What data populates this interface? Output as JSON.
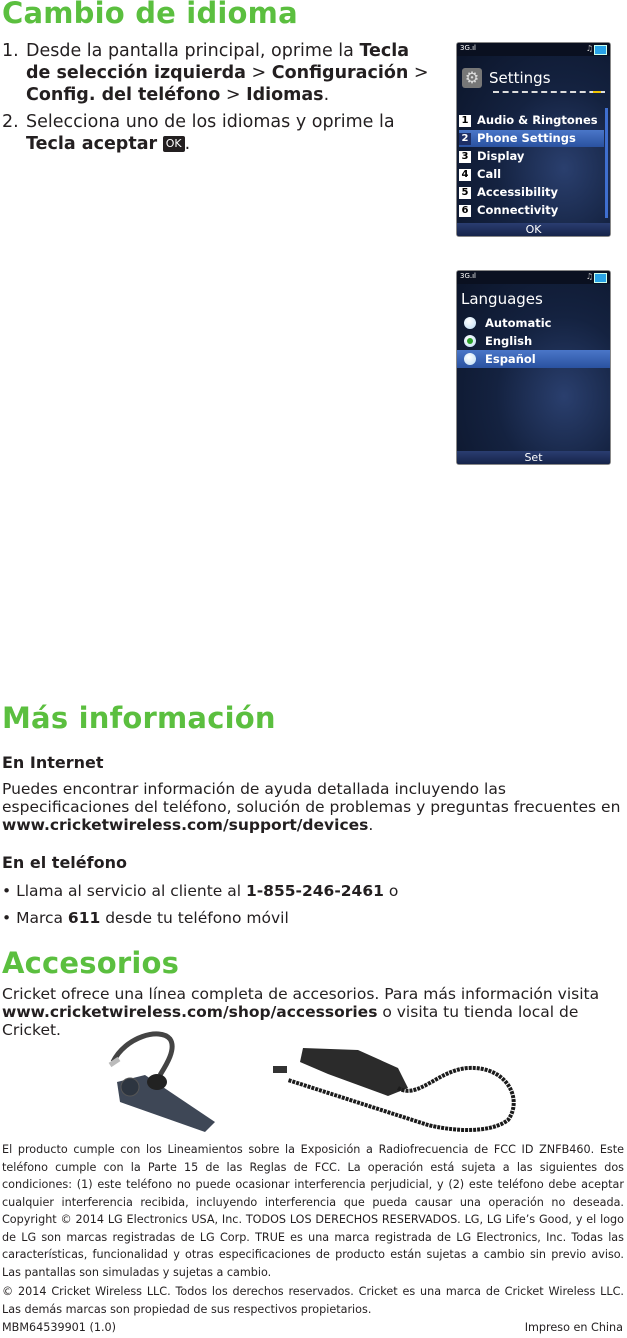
{
  "section1": {
    "title": "Cambio de idioma",
    "steps": [
      {
        "num": "1.",
        "t1": "Desde la pantalla principal, oprime la ",
        "b1": "Tecla de selección izquierda",
        "t2": " > ",
        "b2": "Configuración",
        "t3": " > ",
        "b3": "Config. del teléfono",
        "t4": " > ",
        "b4": "Idiomas",
        "t5": "."
      },
      {
        "num": "2.",
        "t1": "Selecciona uno de los idiomas y oprime la ",
        "b1": "Tecla aceptar",
        "key": "OK",
        "t2": "."
      }
    ]
  },
  "phone_settings": {
    "status_network": "3G",
    "title": "Settings",
    "items": [
      {
        "n": "1",
        "label": "Audio & Ringtones"
      },
      {
        "n": "2",
        "label": "Phone Settings"
      },
      {
        "n": "3",
        "label": "Display"
      },
      {
        "n": "4",
        "label": "Call"
      },
      {
        "n": "5",
        "label": "Accessibility"
      },
      {
        "n": "6",
        "label": "Connectivity"
      }
    ],
    "selected_index": 1,
    "softkey": "OK"
  },
  "phone_languages": {
    "status_network": "3G",
    "title": "Languages",
    "options": [
      "Automatic",
      "English",
      "Español"
    ],
    "checked": "English",
    "highlighted": "Español",
    "softkey": "Set"
  },
  "section2": {
    "title": "Más información",
    "internet": {
      "heading": "En Internet",
      "text": "Puedes encontrar información de ayuda detallada incluyendo las especificaciones del teléfono, solución de problemas y preguntas frecuentes en ",
      "link": "www.cricketwireless.com/support/devices",
      "end": "."
    },
    "phone": {
      "heading": "En el teléfono",
      "bullets": [
        {
          "t1": "• Llama al servicio al cliente al ",
          "b": "1-855-246-2461",
          "t2": " o"
        },
        {
          "t1": "• Marca ",
          "b": "611",
          "t2": " desde tu teléfono móvil"
        }
      ]
    }
  },
  "section3": {
    "title": "Accesorios",
    "t1": "Cricket ofrece una línea completa de accesorios. Para más información visita ",
    "link": "www.cricketwireless.com/shop/accessories",
    "t2": " o visita tu tienda local de Cricket.",
    "images": [
      "bluetooth-headset",
      "car-charger"
    ]
  },
  "legal": {
    "p1": "El producto cumple con los Lineamientos sobre la Exposición a Radiofrecuencia de FCC ID ZNFB460. Este teléfono cumple con la Parte 15 de las Reglas de FCC. La operación está sujeta a las siguientes dos condiciones: (1) este teléfono no puede ocasionar interferencia perjudicial, y (2) este teléfono debe aceptar cualquier interferencia recibida, incluyendo interferencia que pueda causar una operación no deseada. Copyright © 2014 LG Electronics USA, Inc. TODOS LOS DERECHOS RESERVADOS. LG, LG Life’s Good, y el logo de LG son marcas registradas de LG Corp. TRUE es una marca registrada de LG Electronics, Inc. Todas las características, funcionalidad y otras especificaciones de producto están sujetas a cambio sin previo aviso. Las pantallas son simuladas y sujetas a cambio.",
    "p2": "© 2014 Cricket Wireless LLC. Todos los derechos reservados. Cricket es una marca de Cricket Wireless LLC. Las demás marcas son propiedad de sus respectivos propietarios.",
    "part_number": "MBM64539901 (1.0)",
    "printed": "Impreso en China"
  },
  "colors": {
    "accent_green": "#5bbf3f",
    "text": "#231f20"
  }
}
